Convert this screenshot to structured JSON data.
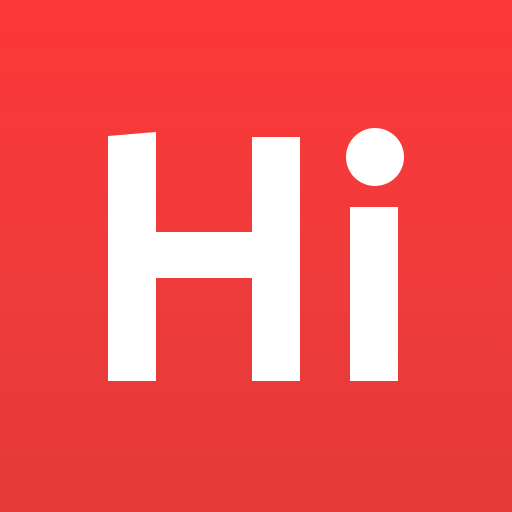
{
  "app_icon": {
    "logo_text": "Hi",
    "colors": {
      "background_top": "#FD3838",
      "background_middle": "#F03B3B",
      "background_bottom": "#E43A3A",
      "glyph": "#FFFFFF"
    }
  }
}
